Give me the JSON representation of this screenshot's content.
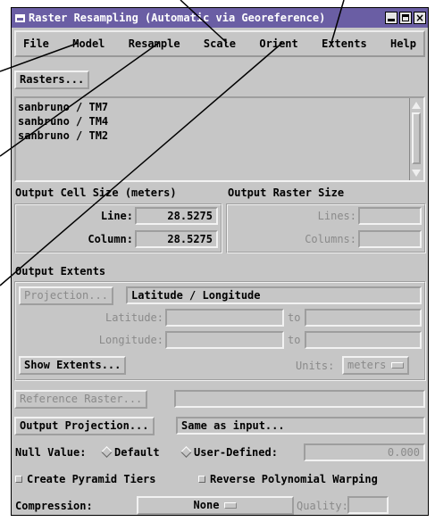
{
  "window": {
    "title": "Raster Resampling (Automatic via Georeference)",
    "controls": [
      "minimize",
      "maximize",
      "close"
    ],
    "close_glyph": "×"
  },
  "menu": [
    "File",
    "Model",
    "Resample",
    "Scale",
    "Orient",
    "Extents",
    "Help"
  ],
  "rasters": {
    "button": "Rasters...",
    "items": [
      "sanbruno / TM7",
      "sanbruno / TM4",
      "sanbruno / TM2"
    ]
  },
  "cell_size": {
    "heading": "Output Cell Size (meters)",
    "line_label": "Line:",
    "line_value": "28.5275",
    "column_label": "Column:",
    "column_value": "28.5275"
  },
  "raster_size": {
    "heading": "Output Raster Size",
    "lines_label": "Lines:",
    "columns_label": "Columns:"
  },
  "extents": {
    "heading": "Output Extents",
    "projection_button": "Projection...",
    "projection_value": "Latitude / Longitude",
    "latitude_label": "Latitude:",
    "longitude_label": "Longitude:",
    "to": "to",
    "show_button": "Show Extents...",
    "units_label": "Units:",
    "units_value": "meters"
  },
  "reference": {
    "button": "Reference Raster..."
  },
  "output_projection": {
    "button": "Output Projection...",
    "value": "Same as input..."
  },
  "null_value": {
    "label": "Null Value:",
    "default_label": "Default",
    "user_label": "User-Defined:",
    "value": "0.000"
  },
  "options": {
    "pyramid": "Create Pyramid Tiers",
    "polynomial": "Reverse Polynomial Warping"
  },
  "compression": {
    "label": "Compression:",
    "value": "None",
    "quality_label": "Quality:"
  },
  "colors": {
    "title_bg": "#6a5ea4",
    "panel": "#c6c6c6",
    "disabled_text": "#8a8a8a"
  }
}
